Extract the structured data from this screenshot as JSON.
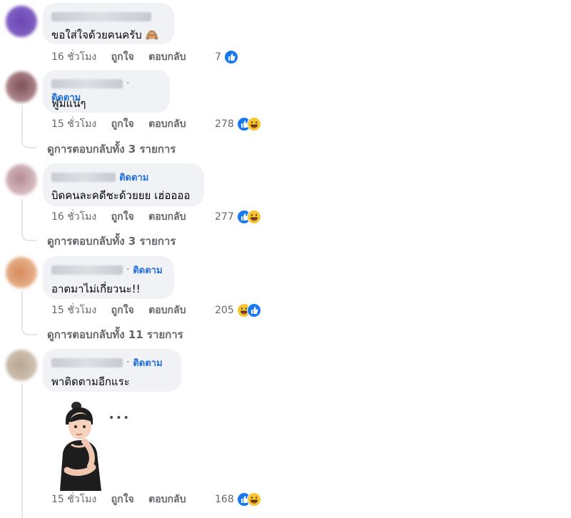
{
  "comments": [
    {
      "text": "ขอใส่ใจด้วยคนครับ",
      "emoji": "🙈",
      "time": "16 ชั่วโมง",
      "like_label": "ถูกใจ",
      "reply_label": "ตอบกลับ",
      "reaction_count": "7",
      "follow_label": ""
    },
    {
      "text": "ฟูมแน่ๆ",
      "time": "15 ชั่วโมง",
      "like_label": "ถูกใจ",
      "reply_label": "ตอบกลับ",
      "reaction_count": "278",
      "follow_label": "ติดตาม",
      "view_replies": "ดูการตอบกลับทั้ง 3 รายการ"
    },
    {
      "text": "บิดคนละคดีชะด้วยยย เฮ่ออออ",
      "time": "16 ชั่วโมง",
      "like_label": "ถูกใจ",
      "reply_label": "ตอบกลับ",
      "reaction_count": "277",
      "follow_label": "ติดตาม",
      "view_replies": "ดูการตอบกลับทั้ง 3 รายการ"
    },
    {
      "text": "อาตมาไม่เกี่ยวนะ!!",
      "time": "15 ชั่วโมง",
      "like_label": "ถูกใจ",
      "reply_label": "ตอบกลับ",
      "reaction_count": "205",
      "follow_label": "ติดตาม",
      "view_replies": "ดูการตอบกลับทั้ง 11 รายการ"
    },
    {
      "text": "พาติดตามอีกแระ",
      "time": "15 ชั่วโมง",
      "like_label": "ถูกใจ",
      "reply_label": "ตอบกลับ",
      "reaction_count": "168",
      "follow_label": "ติดตาม",
      "sticker_dots": "•••"
    }
  ],
  "colors": {
    "link": "#216fdb",
    "meta": "#65676b",
    "bubble": "#f0f2f5",
    "like": "#1877f2"
  }
}
